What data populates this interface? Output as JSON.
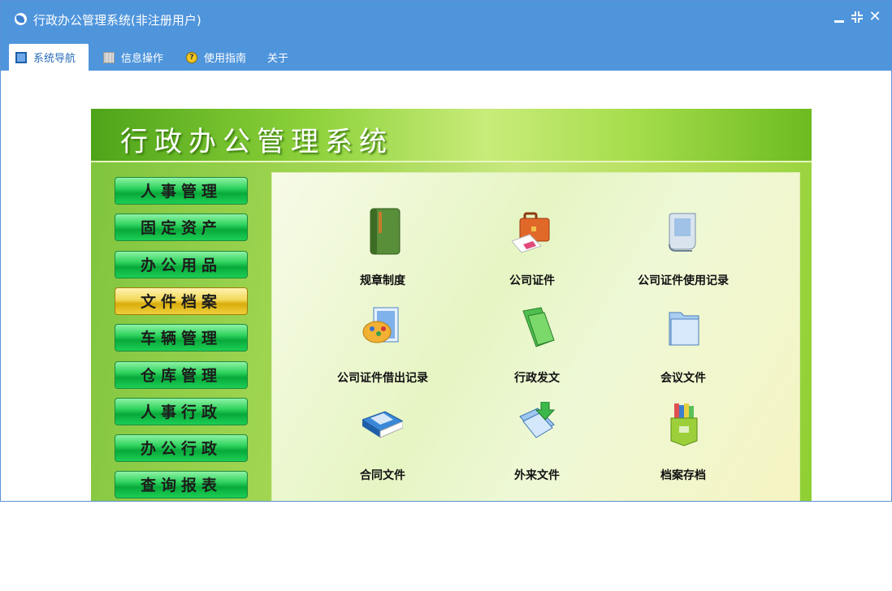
{
  "window": {
    "title": "行政办公管理系统(非注册用户)"
  },
  "menu": [
    {
      "label": "系统导航",
      "icon": "monitor-icon"
    },
    {
      "label": "信息操作",
      "icon": "grid-icon"
    },
    {
      "label": "使用指南",
      "icon": "help-icon"
    },
    {
      "label": "关于",
      "icon": ""
    }
  ],
  "panel": {
    "title": "行政办公管理系统",
    "nav": [
      "人事管理",
      "固定资产",
      "办公用品",
      "文件档案",
      "车辆管理",
      "仓库管理",
      "人事行政",
      "办公行政",
      "查询报表"
    ],
    "selected_nav": "文件档案",
    "tiles": [
      {
        "label": "规章制度",
        "icon": "rules-book-icon"
      },
      {
        "label": "公司证件",
        "icon": "briefcase-icon"
      },
      {
        "label": "公司证件使用记录",
        "icon": "document-scroll-icon"
      },
      {
        "label": "公司证件借出记录",
        "icon": "palette-document-icon"
      },
      {
        "label": "行政发文",
        "icon": "green-folder-icon"
      },
      {
        "label": "会议文件",
        "icon": "blue-folder-icon"
      },
      {
        "label": "合同文件",
        "icon": "contract-book-icon"
      },
      {
        "label": "外来文件",
        "icon": "incoming-file-icon"
      },
      {
        "label": "档案存档",
        "icon": "archive-box-icon"
      }
    ]
  },
  "colors": {
    "titlebar": "#4f95dc",
    "nav_button": "#08a93a",
    "nav_selected": "#d9ad0c",
    "panel": "#8fcf33"
  }
}
